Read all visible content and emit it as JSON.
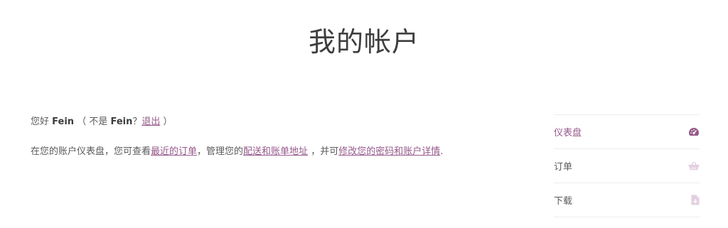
{
  "page": {
    "title": "我的帐户"
  },
  "greeting": {
    "hello": "您好",
    "username": "Fein",
    "not_prefix": "（ 不是",
    "username2": "Fein",
    "question": "？",
    "logout_link": "退出",
    "close": "）"
  },
  "dashboard_text": {
    "part1": "在您的账户仪表盘，您可查看",
    "recent_orders_link": "最近的订单",
    "part2": "，管理您的",
    "addresses_link": "配送和账单地址",
    "part3": "，并可",
    "account_details_link": "修改您的密码和账户详情",
    "part4": "."
  },
  "navigation": {
    "items": [
      {
        "label": "仪表盘",
        "icon": "dashboard-gauge-icon",
        "active": true
      },
      {
        "label": "订单",
        "icon": "shopping-basket-icon",
        "active": false
      },
      {
        "label": "下载",
        "icon": "file-download-icon",
        "active": false
      }
    ]
  },
  "colors": {
    "accent": "#96588a",
    "text": "#5a5a5a",
    "heading": "#3d3d3d",
    "icon_light": "#e2cfdf",
    "border": "#ececec"
  }
}
